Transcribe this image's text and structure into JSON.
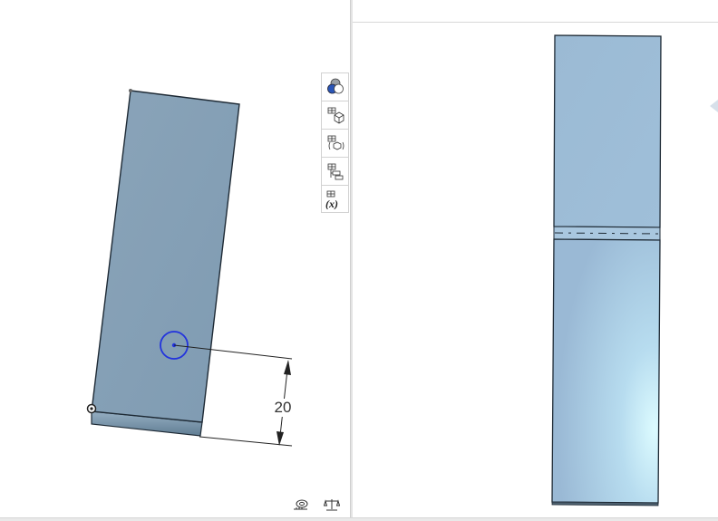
{
  "sketch": {
    "dimension_value": "20"
  },
  "toolbar": {
    "tools": [
      {
        "icon": "display-states-icon"
      },
      {
        "icon": "view-cube-icon"
      },
      {
        "icon": "configurations-icon"
      },
      {
        "icon": "feature-variables-icon"
      },
      {
        "icon": "variable-x-icon"
      }
    ],
    "variable_symbol": "(x)"
  },
  "bottom_bar": {
    "icons": [
      "measure-tape-icon",
      "mass-properties-icon"
    ]
  },
  "colors": {
    "part_left": "#8da7bd",
    "part_right_top": "#9ab9d4",
    "part_right_bottom": "#c4e6f4",
    "edge": "#1e2a35",
    "sketch_circle": "#2233dd"
  }
}
